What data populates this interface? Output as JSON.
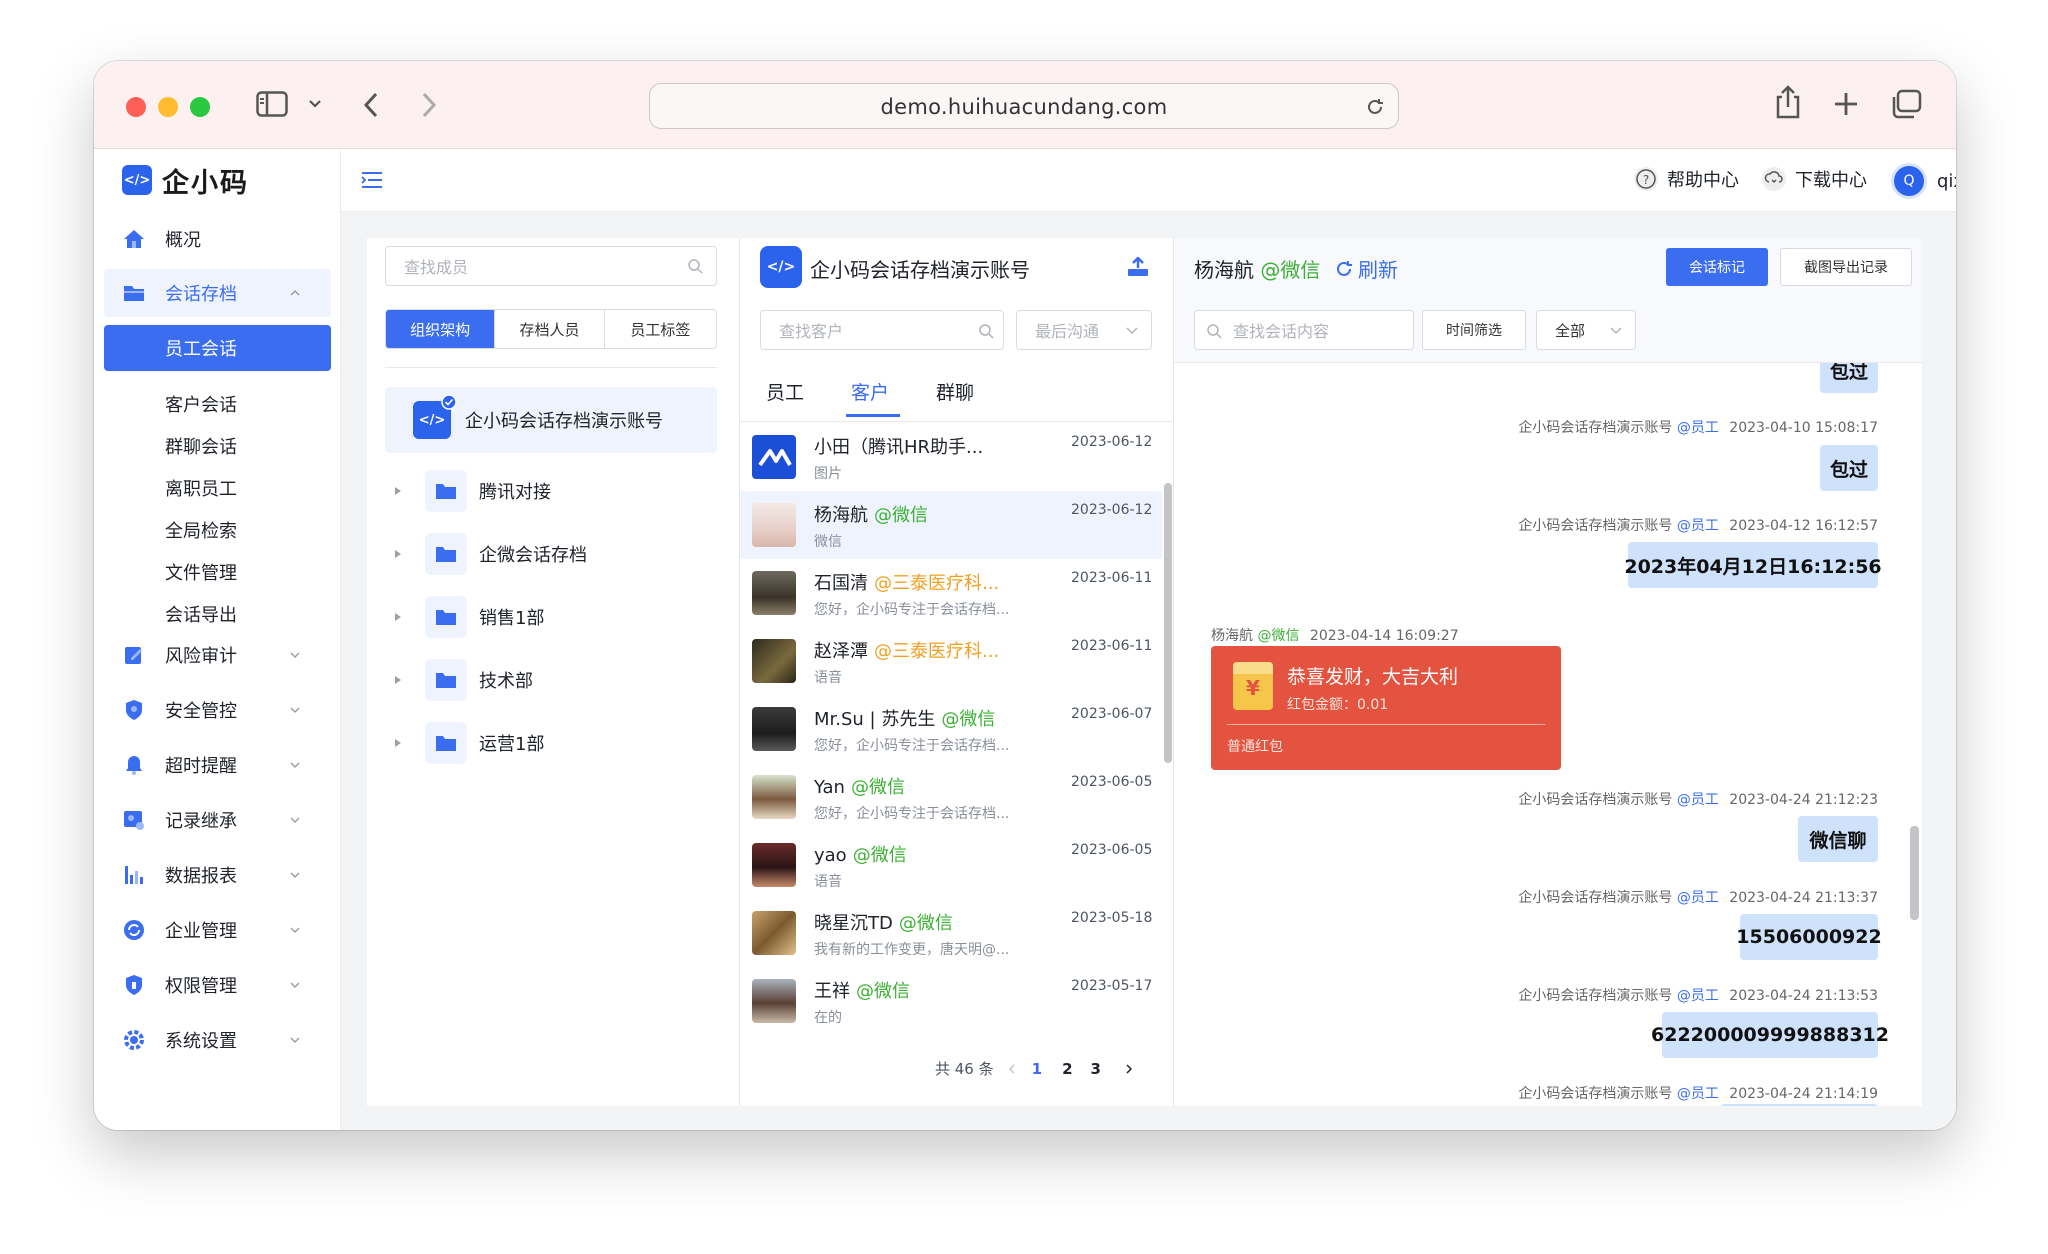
{
  "browser": {
    "url": "demo.huihuacundang.com"
  },
  "sidebar": {
    "logo_mark": "</>",
    "logo_text": "企小码",
    "items": [
      {
        "label": "概况",
        "icon": "home-icon"
      },
      {
        "label": "会话存档",
        "icon": "folder-icon",
        "expanded": true
      },
      {
        "label": "风险审计",
        "icon": "audit-icon"
      },
      {
        "label": "安全管控",
        "icon": "shield-icon"
      },
      {
        "label": "超时提醒",
        "icon": "bell-icon"
      },
      {
        "label": "记录继承",
        "icon": "inherit-icon"
      },
      {
        "label": "数据报表",
        "icon": "chart-icon"
      },
      {
        "label": "企业管理",
        "icon": "enterprise-icon"
      },
      {
        "label": "权限管理",
        "icon": "permission-icon"
      },
      {
        "label": "系统设置",
        "icon": "gear-icon"
      }
    ],
    "sub_items": [
      "员工会话",
      "客户会话",
      "群聊会话",
      "离职员工",
      "全局检索",
      "文件管理",
      "会话导出"
    ],
    "active_sub": "员工会话"
  },
  "topbar": {
    "help": "帮助中心",
    "download": "下载中心",
    "avatar_letter": "Q",
    "user": "qixiaoma"
  },
  "members": {
    "search_placeholder": "查找成员",
    "tabs": [
      "组织架构",
      "存档人员",
      "员工标签"
    ],
    "active_tab": "组织架构",
    "root": "企小码会话存档演示账号",
    "root_mark": "</>",
    "folders": [
      "腾讯对接",
      "企微会话存档",
      "销售1部",
      "技术部",
      "运营1部"
    ]
  },
  "conversations": {
    "account_title": "企小码会话存档演示账号",
    "account_mark": "</>",
    "search_placeholder": "查找客户",
    "sort_placeholder": "最后沟通",
    "tabs": [
      "员工",
      "客户",
      "群聊"
    ],
    "active_tab": "客户",
    "items": [
      {
        "name": "小田（腾讯HR助手...",
        "tag": "",
        "tag_color": "",
        "preview": "图片",
        "date": "2023-06-12"
      },
      {
        "name": "杨海航",
        "tag": "@微信",
        "tag_color": "#3cb034",
        "preview": "微信",
        "date": "2023-06-12",
        "selected": true
      },
      {
        "name": "石国清",
        "tag": "@三泰医疗科...",
        "tag_color": "#f0a020",
        "preview": "您好，企小码专注于会话存档...",
        "date": "2023-06-11"
      },
      {
        "name": "赵泽潭",
        "tag": "@三泰医疗科...",
        "tag_color": "#f0a020",
        "preview": "语音",
        "date": "2023-06-11"
      },
      {
        "name": "Mr.Su | 苏先生",
        "tag": "@微信",
        "tag_color": "#3cb034",
        "preview": "您好，企小码专注于会话存档...",
        "date": "2023-06-07"
      },
      {
        "name": "Yan",
        "tag": "@微信",
        "tag_color": "#3cb034",
        "preview": "您好，企小码专注于会话存档...",
        "date": "2023-06-05"
      },
      {
        "name": "yao",
        "tag": "@微信",
        "tag_color": "#3cb034",
        "preview": "语音",
        "date": "2023-06-05"
      },
      {
        "name": "晓星沉TD",
        "tag": "@微信",
        "tag_color": "#3cb034",
        "preview": "我有新的工作变更，唐天明@...",
        "date": "2023-05-18"
      },
      {
        "name": "王祥",
        "tag": "@微信",
        "tag_color": "#3cb034",
        "preview": "在的",
        "date": "2023-05-17"
      }
    ],
    "pagination": {
      "total": "共 46 条",
      "pages": [
        "1",
        "2",
        "3"
      ],
      "current": "1"
    }
  },
  "chat": {
    "contact": "杨海航",
    "contact_tag": "@微信",
    "refresh": "刷新",
    "mark_btn": "会话标记",
    "export_btn": "截图导出记录",
    "search_placeholder": "查找会话内容",
    "time_filter": "时间筛选",
    "scope": "全部",
    "messages": [
      {
        "sender": "",
        "tag": "",
        "time": "",
        "text": "包过",
        "partial": true
      },
      {
        "sender": "企小码会话存档演示账号",
        "tag": "@员工",
        "time": "2023-04-10 15:08:17",
        "text": "包过"
      },
      {
        "sender": "企小码会话存档演示账号",
        "tag": "@员工",
        "time": "2023-04-12 16:12:57",
        "text": "2023年04月12日16:12:56"
      },
      {
        "sender": "杨海航",
        "tag": "@微信",
        "time": "2023-04-14 16:09:27",
        "type": "redpacket",
        "title": "恭喜发财，大吉大利",
        "amount": "红包金额：0.01",
        "kind": "普通红包",
        "symbol": "¥"
      },
      {
        "sender": "企小码会话存档演示账号",
        "tag": "@员工",
        "time": "2023-04-24 21:12:23",
        "text": "微信聊"
      },
      {
        "sender": "企小码会话存档演示账号",
        "tag": "@员工",
        "time": "2023-04-24 21:13:37",
        "text": "15506000922"
      },
      {
        "sender": "企小码会话存档演示账号",
        "tag": "@员工",
        "time": "2023-04-24 21:13:53",
        "text": "622200009999888312"
      },
      {
        "sender": "企小码会话存档演示账号",
        "tag": "@员工",
        "time": "2023-04-24 21:14:19",
        "text": ""
      }
    ]
  },
  "colors": {
    "primary": "#3a6df0",
    "wechat_green": "#3cb034",
    "company_orange": "#f0a020",
    "bubble": "#cfe2fb",
    "redpacket": "#e3533f"
  }
}
